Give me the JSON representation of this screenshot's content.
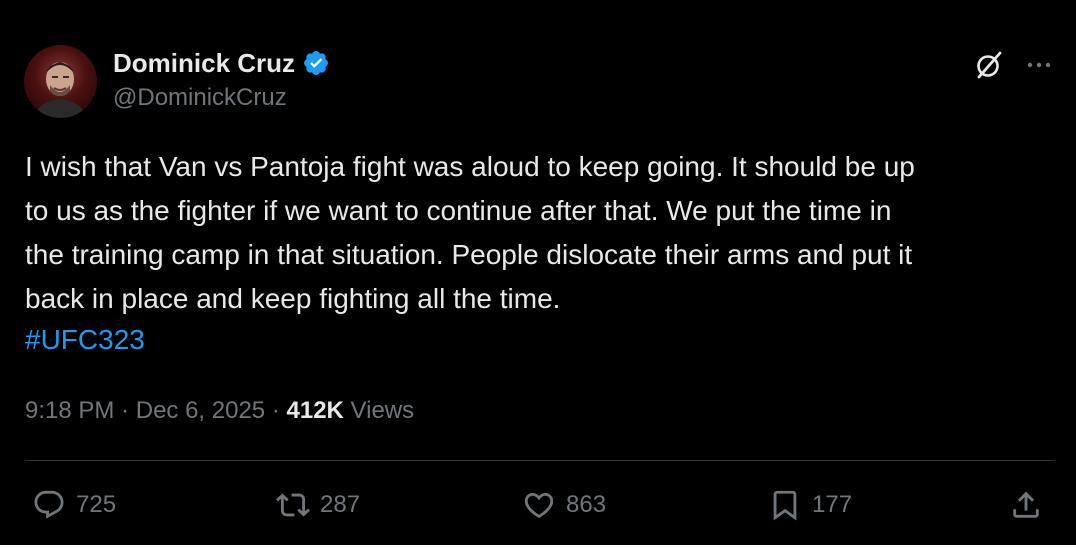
{
  "author": {
    "display_name": "Dominick Cruz",
    "handle": "@DominickCruz",
    "verified": true,
    "avatar_icon": "profile-photo"
  },
  "tweet": {
    "text": "I wish that Van vs Pantoja fight was aloud to keep going. It should be up\nto us as the fighter if we want to continue after that. We put the time in\nthe training camp in that situation. People dislocate their arms and put it\nback in place and keep fighting all the time.",
    "hashtag": "#UFC323",
    "time": "9:18 PM",
    "separator": "·",
    "date": "Dec 6, 2025",
    "views_count": "412K",
    "views_label": "Views"
  },
  "actions": {
    "reply_count": "725",
    "repost_count": "287",
    "like_count": "863",
    "bookmark_count": "177"
  },
  "icons": {
    "header": [
      "grok-icon",
      "more-icon"
    ],
    "actions": [
      "reply-icon",
      "repost-icon",
      "like-icon",
      "bookmark-icon",
      "share-icon"
    ]
  },
  "colors": {
    "background": "#000000",
    "text": "#e7e9ea",
    "secondary_text": "#71767b",
    "link": "#1d9bf0",
    "verified_badge": "#1d9bf0",
    "divider": "#2f3336"
  }
}
